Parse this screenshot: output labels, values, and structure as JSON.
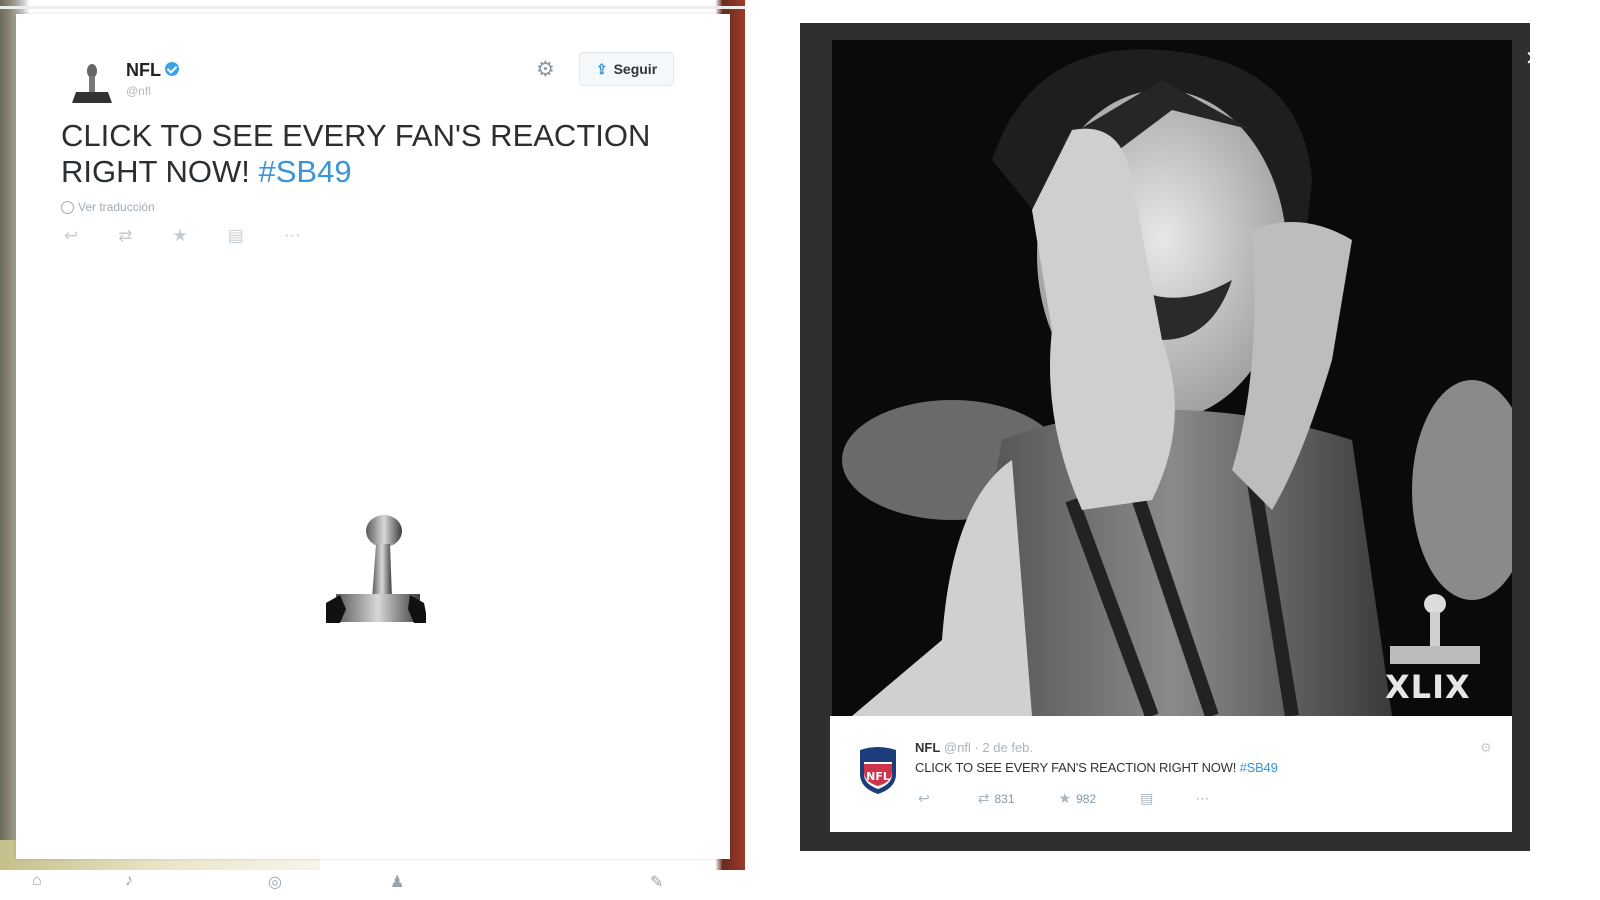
{
  "left_tweet": {
    "user_name": "NFL",
    "user_handle": "@nfl",
    "follow_label": "Seguir",
    "text": "CLICK TO SEE EVERY FAN'S REACTION RIGHT NOW! ",
    "hashtag": "#SB49",
    "translate_label": "Ver traducción",
    "icons": [
      "reply-icon",
      "retweet-icon",
      "favorite-icon",
      "save-icon",
      "more-icon"
    ]
  },
  "right_tweet": {
    "user_name": "NFL",
    "user_handle": "@nfl",
    "date": "· 2 de feb.",
    "text": "CLICK TO SEE EVERY FAN'S REACTION RIGHT NOW! ",
    "hashtag": "#SB49",
    "retweet_count": "831",
    "favorite_count": "982",
    "badge_text": "XLIX"
  },
  "colors": {
    "accent": "#3b94d9",
    "frame": "#2f2f2f"
  }
}
